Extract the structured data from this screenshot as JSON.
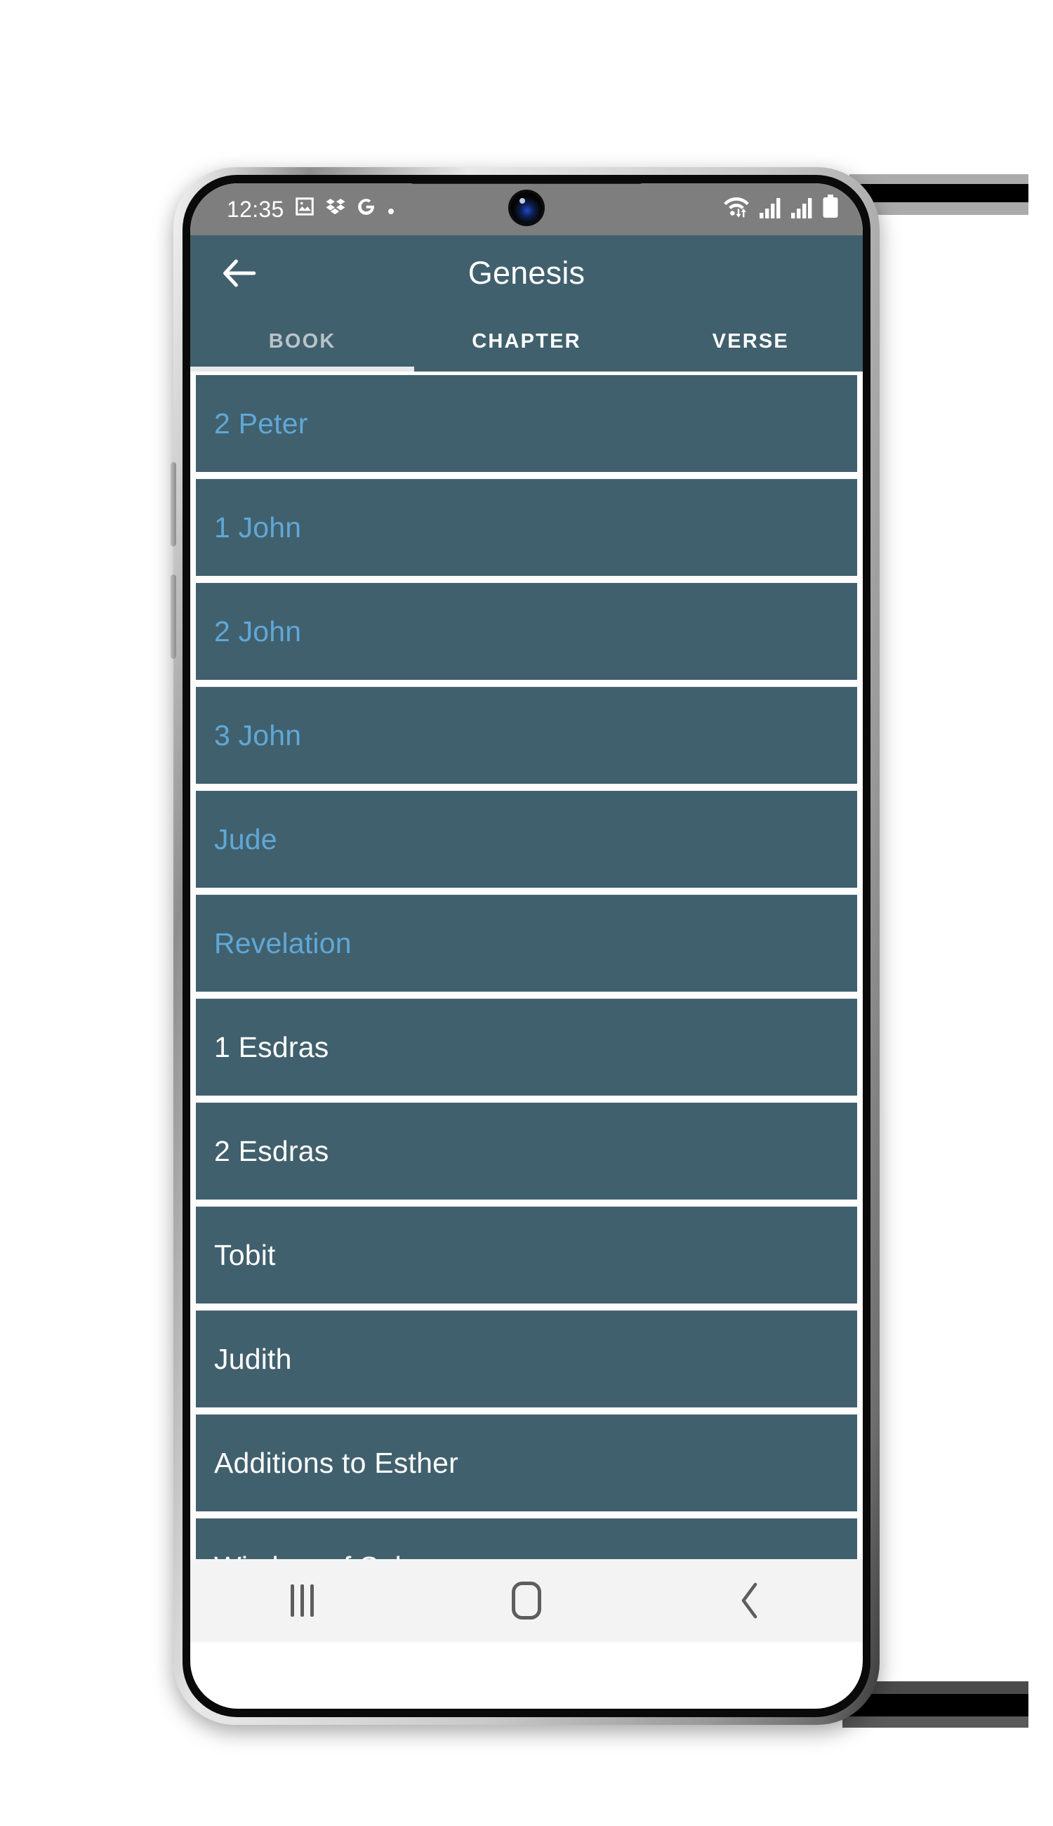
{
  "status_bar": {
    "time": "12:35",
    "left_icons": [
      "photo-icon",
      "dropbox-icon",
      "google-icon",
      "dot-icon"
    ],
    "right_icons": [
      "wifi-icon",
      "signal-sim1-icon",
      "signal-sim2-icon",
      "battery-icon"
    ],
    "background": "#7e7e7e"
  },
  "app_bar": {
    "back_icon": "back-arrow-icon",
    "title": "Genesis",
    "background": "#41606d"
  },
  "tabs": {
    "active_index": 0,
    "items": [
      {
        "label": "BOOK"
      },
      {
        "label": "CHAPTER"
      },
      {
        "label": "VERSE"
      }
    ]
  },
  "list": {
    "item_background": "#41606d",
    "link_color": "#5fa8d8",
    "plain_color": "#ffffff",
    "items": [
      {
        "label": "2 Peter",
        "style": "link"
      },
      {
        "label": "1 John",
        "style": "link"
      },
      {
        "label": "2 John",
        "style": "link"
      },
      {
        "label": "3 John",
        "style": "link"
      },
      {
        "label": "Jude",
        "style": "link"
      },
      {
        "label": "Revelation",
        "style": "link"
      },
      {
        "label": "1 Esdras",
        "style": "plain"
      },
      {
        "label": "2 Esdras",
        "style": "plain"
      },
      {
        "label": "Tobit",
        "style": "plain"
      },
      {
        "label": "Judith",
        "style": "plain"
      },
      {
        "label": "Additions to Esther",
        "style": "plain"
      },
      {
        "label": "Wisdom of Solomon",
        "style": "plain"
      },
      {
        "label": "",
        "style": "plain"
      }
    ]
  },
  "nav_bar": {
    "buttons": [
      {
        "name": "recents-icon"
      },
      {
        "name": "home-icon"
      },
      {
        "name": "back-icon"
      }
    ],
    "background": "#f3f3f3"
  }
}
